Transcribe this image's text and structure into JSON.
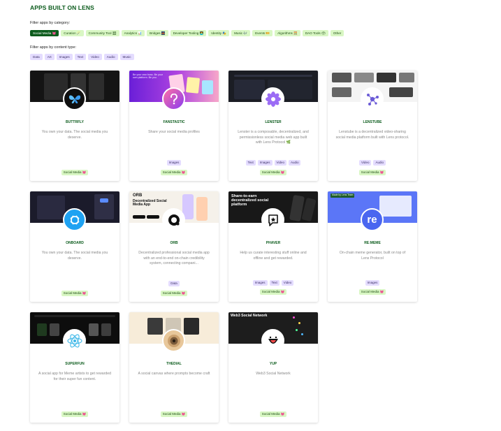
{
  "page": {
    "title": "APPS BUILT ON LENS"
  },
  "filters": {
    "category_caption": "Filter apps by category:",
    "categories": [
      {
        "label": "Social Media 💓",
        "active": true
      },
      {
        "label": "Curation 🪄",
        "active": false
      },
      {
        "label": "Community Tool 🎛",
        "active": false
      },
      {
        "label": "Analytics 📊",
        "active": false
      },
      {
        "label": "Bridges 🌉",
        "active": false
      },
      {
        "label": "Developer Tooling 👨‍💻",
        "active": false
      },
      {
        "label": "Identity 🎭",
        "active": false
      },
      {
        "label": "Music 🎶",
        "active": false
      },
      {
        "label": "Events 🎫",
        "active": false
      },
      {
        "label": "Algorithms 🧮",
        "active": false
      },
      {
        "label": "DAO Tools 🗳",
        "active": false
      },
      {
        "label": "Other",
        "active": false
      }
    ],
    "content_caption": "Filter apps by content type:",
    "content_types": [
      "Data",
      "Art",
      "Images",
      "Text",
      "Video",
      "Audio",
      "Music"
    ]
  },
  "apps": [
    {
      "name": "BUTTRFLY",
      "icon": "butterfly-icon",
      "description": "You own your data. The social media you deserve.",
      "content_types": [],
      "category": "Social Media 💓"
    },
    {
      "name": "FANSTASTIC",
      "icon": "fanstastic-icon",
      "description": "Share your social media profiles",
      "content_types": [
        "Images"
      ],
      "category": "Social Media 💓",
      "banner_text": "Be your own boss. Be your own platform. Be you."
    },
    {
      "name": "LENSTER",
      "icon": "flower-icon",
      "description": "Lenster is a composable, decentralized, and permissionless social media web app built with Lens Protocol 🌿",
      "content_types": [
        "Text",
        "Images",
        "Video",
        "Audio"
      ],
      "category": "Social Media 💓"
    },
    {
      "name": "LENSTUBE",
      "icon": "lenstube-icon",
      "description": "Lenstube is a decentralized video-sharing social media platform built with Lens protocol.",
      "content_types": [
        "Video",
        "Audio"
      ],
      "category": "Social Media 💓"
    },
    {
      "name": "ONBOARD",
      "icon": "onboard-icon",
      "description": "You own your data. The social media you deserve.",
      "content_types": [],
      "category": "Social Media 💓"
    },
    {
      "name": "ORB",
      "icon": "orb-icon",
      "description": "Decentralized professional social media app with an end-to-end on-chain credibility system, connecting compani...",
      "content_types": [
        "Data"
      ],
      "category": "Social Media 💓",
      "banner_text": "Decentralized Social Media App",
      "banner_brand": "ORB"
    },
    {
      "name": "PHAVER",
      "icon": "phaver-icon",
      "description": "Help us curate interesting stuff online and offline and get rewarded.",
      "content_types": [
        "Images",
        "Text",
        "Video"
      ],
      "category": "Social Media 💓",
      "banner_text": "Share-to-earn decentralized social platform"
    },
    {
      "name": "RE:MEME",
      "icon": "reme-icon",
      "description": "On-chain meme generator, built on top of Lens Protocol",
      "content_types": [
        "Images"
      ],
      "category": "Social Media 💓",
      "banner_badge": "Made by Lens Team",
      "logo_text": "re"
    },
    {
      "name": "SUPERFUN",
      "icon": "react-atom-icon",
      "description": "A social app for Meme artists to get rewarded for their super fun content.",
      "content_types": [],
      "category": "Social Media 💓"
    },
    {
      "name": "THEDIAL",
      "icon": "dial-icon",
      "description": "A social canvas where prompts become craft",
      "content_types": [],
      "category": "Social Media 💓"
    },
    {
      "name": "YUP",
      "icon": "yup-icon",
      "description": "Web3 Social Network",
      "content_types": [],
      "category": "Social Media 💓",
      "banner_text": "Web3 Social Network"
    }
  ],
  "colors": {
    "title_green": "#0b5b1c",
    "category_chip": "#d9f7c4",
    "category_chip_active": "#0b5b1c",
    "content_chip": "#e4dcff"
  }
}
